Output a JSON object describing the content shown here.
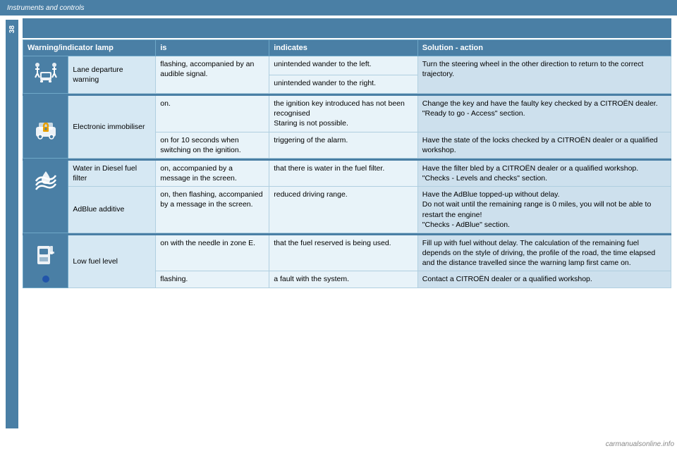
{
  "header": {
    "title": "Instruments and controls",
    "page_number": "38"
  },
  "table": {
    "columns": [
      "Warning/indicator lamp",
      "is",
      "indicates",
      "Solution - action"
    ],
    "section_header_bg": "#4a7fa5",
    "rows": [
      {
        "icon_type": "lane",
        "name": "Lane departure warning",
        "sub_rows": [
          {
            "is": "flashing, accompanied by an audible signal.",
            "indicates": "unintended wander to the left.",
            "solution": "Turn the steering wheel in the other direction to return to the correct trajectory.",
            "rowspan_solution": 2
          },
          {
            "is": "",
            "indicates": "unintended wander to the right.",
            "solution": ""
          }
        ]
      },
      {
        "icon_type": "immobiliser",
        "name": "Electronic immobiliser",
        "sub_rows": [
          {
            "is": "on.",
            "indicates": "the ignition key introduced has not been recognised\nStaring is not possible.",
            "solution": "Change the key and have the faulty key checked by a CITROËN dealer.\n\"Ready to go - Access\" section.",
            "rowspan_is": 1
          },
          {
            "is": "on for 10 seconds when switching on the ignition.",
            "indicates": "triggering of the alarm.",
            "solution": "Have the state of the locks checked by a CITROËN dealer or a qualified workshop."
          }
        ]
      },
      {
        "icon_type": "water",
        "name": "Water in Diesel fuel filter",
        "sub_rows": [
          {
            "is": "on, accompanied by a message in the screen.",
            "indicates": "that there is water in the fuel filter.",
            "solution": "Have the filter bled by a CITROËN dealer or a qualified workshop.\n\"Checks - Levels and checks\" section."
          }
        ]
      },
      {
        "icon_type": "adblue",
        "name": "AdBlue additive",
        "sub_rows": [
          {
            "is": "on, then flashing, accompanied by a message in the screen.",
            "indicates": "reduced driving range.",
            "solution": "Have the AdBlue topped-up without delay.\nDo not wait until the remaining range is 0 miles, you will not be able to restart the engine!\n\"Checks - AdBlue\" section."
          }
        ]
      },
      {
        "icon_type": "fuel",
        "name": "Low fuel level",
        "sub_rows": [
          {
            "is": "on with the needle in zone E.",
            "indicates": "that the fuel reserved is being used.",
            "solution": "Fill up with fuel without delay. The calculation of the remaining fuel depends on the style of driving, the profile of the road, the time elapsed and the distance travelled since the warning lamp first came on."
          },
          {
            "is": "flashing.",
            "indicates": "a fault with the system.",
            "solution": "Contact a CITROËN dealer or a qualified workshop."
          }
        ]
      }
    ]
  },
  "watermark": "carmanualsonline.info"
}
